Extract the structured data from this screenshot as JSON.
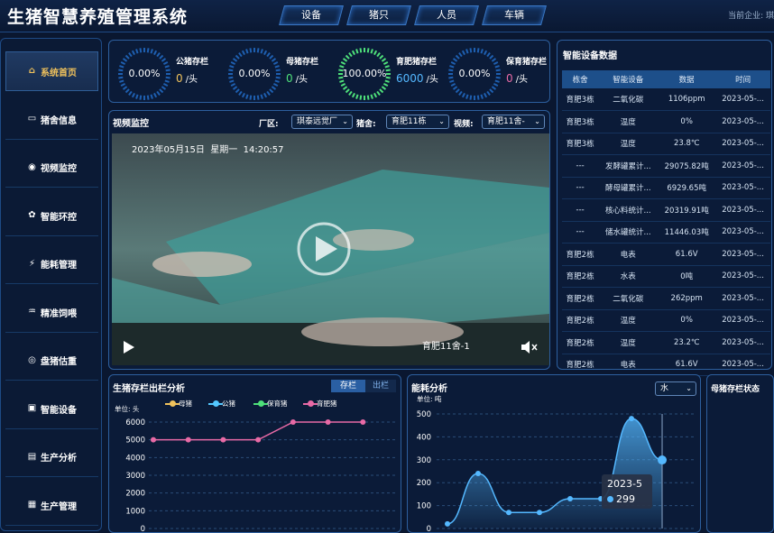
{
  "header": {
    "title": "生猪智慧养殖管理系统",
    "nav": [
      "设备",
      "猪只",
      "人员",
      "车辆"
    ],
    "company_label": "当前企业: 琪"
  },
  "sidebar": {
    "items": [
      {
        "label": "系统首页",
        "icon": "home-icon",
        "active": true
      },
      {
        "label": "猪舍信息",
        "icon": "barn-icon"
      },
      {
        "label": "视频监控",
        "icon": "camera-icon"
      },
      {
        "label": "智能环控",
        "icon": "environment-icon"
      },
      {
        "label": "能耗管理",
        "icon": "energy-icon"
      },
      {
        "label": "精准饲喂",
        "icon": "feeding-icon"
      },
      {
        "label": "盘猪估重",
        "icon": "weight-icon"
      },
      {
        "label": "智能设备",
        "icon": "device-icon"
      },
      {
        "label": "生产分析",
        "icon": "analysis-icon"
      },
      {
        "label": "生产管理",
        "icon": "grid-icon"
      }
    ]
  },
  "stats": [
    {
      "label": "公猪存栏",
      "pct": "0.00%",
      "value": "0",
      "unit": "/头",
      "color": "#f0c25c",
      "fill": 0
    },
    {
      "label": "母猪存栏",
      "pct": "0.00%",
      "value": "0",
      "unit": "/头",
      "color": "#4ee07a",
      "fill": 0
    },
    {
      "label": "育肥猪存栏",
      "pct": "100.00%",
      "value": "6000",
      "unit": "/头",
      "color": "#54b8ff",
      "fill": 1
    },
    {
      "label": "保育猪存栏",
      "pct": "0.00%",
      "value": "0",
      "unit": "/头",
      "color": "#e86aa6",
      "fill": 0
    }
  ],
  "video": {
    "title": "视频监控",
    "filters": [
      {
        "label": "厂区:",
        "value": "琪泰远觉厂"
      },
      {
        "label": "猪舍:",
        "value": "育肥11栋"
      },
      {
        "label": "视频:",
        "value": "育肥11舍-"
      }
    ],
    "timestamp": "2023年05月15日  星期一  14:20:57",
    "camera_label": "育肥11舍-1"
  },
  "devices": {
    "title": "智能设备数据",
    "columns": [
      "栋舍",
      "智能设备",
      "数据",
      "时间"
    ],
    "rows": [
      [
        "育肥3栋",
        "二氧化碳",
        "1106ppm",
        "2023-05-..."
      ],
      [
        "育肥3栋",
        "温度",
        "0%",
        "2023-05-..."
      ],
      [
        "育肥3栋",
        "温度",
        "23.8℃",
        "2023-05-..."
      ],
      [
        "---",
        "发酵罐累计...",
        "29075.82吨",
        "2023-05-..."
      ],
      [
        "---",
        "酵母罐累计...",
        "6929.65吨",
        "2023-05-..."
      ],
      [
        "---",
        "核心料统计...",
        "20319.91吨",
        "2023-05-..."
      ],
      [
        "---",
        "储水罐统计...",
        "11446.03吨",
        "2023-05-..."
      ],
      [
        "育肥2栋",
        "电表",
        "61.6V",
        "2023-05-..."
      ],
      [
        "育肥2栋",
        "水表",
        "0吨",
        "2023-05-..."
      ],
      [
        "育肥2栋",
        "二氧化碳",
        "262ppm",
        "2023-05-..."
      ],
      [
        "育肥2栋",
        "温度",
        "0%",
        "2023-05-..."
      ],
      [
        "育肥2栋",
        "温度",
        "23.2℃",
        "2023-05-..."
      ],
      [
        "育肥2栋",
        "电表",
        "61.6V",
        "2023-05-..."
      ]
    ]
  },
  "inventory_chart": {
    "title": "生猪存栏出栏分析",
    "tabs": [
      "存栏",
      "出栏"
    ],
    "unit": "单位: 头",
    "legend": [
      {
        "name": "母猪",
        "color": "#f0c25c"
      },
      {
        "name": "公猪",
        "color": "#54c8ff"
      },
      {
        "name": "保育猪",
        "color": "#4ee07a"
      },
      {
        "name": "育肥猪",
        "color": "#e86aa6"
      }
    ],
    "y_ticks": [
      "6000",
      "5000",
      "4000",
      "3000",
      "2000",
      "1000",
      "0"
    ]
  },
  "energy_chart": {
    "title": "能耗分析",
    "unit": "单位: 吨",
    "select": "水",
    "y_ticks": [
      "500",
      "400",
      "300",
      "200",
      "100",
      "0"
    ],
    "tooltip_label": "2023-5",
    "tooltip_value": "299"
  },
  "status_panel": {
    "title": "母猪存栏状态"
  },
  "chart_data": [
    {
      "type": "line",
      "title": "生猪存栏出栏分析",
      "ylabel": "单位: 头",
      "ylim": [
        0,
        6000
      ],
      "x": [
        0,
        1,
        2,
        3,
        4,
        5,
        6
      ],
      "series": [
        {
          "name": "育肥猪",
          "color": "#e86aa6",
          "values": [
            5000,
            5000,
            5000,
            5000,
            6000,
            6000,
            6000
          ]
        }
      ]
    },
    {
      "type": "area",
      "title": "能耗分析",
      "ylabel": "单位: 吨",
      "ylim": [
        0,
        500
      ],
      "x": [
        0,
        1,
        2,
        3,
        4,
        5,
        6,
        7
      ],
      "series": [
        {
          "name": "水",
          "color": "#54b8ff",
          "values": [
            20,
            240,
            70,
            70,
            130,
            130,
            480,
            299
          ]
        }
      ]
    }
  ]
}
